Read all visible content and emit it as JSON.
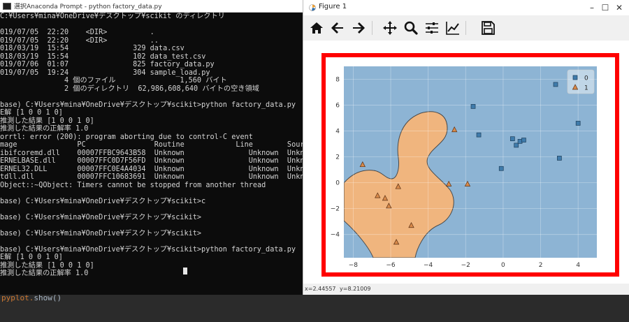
{
  "console": {
    "title": "選択Anaconda Prompt - python  factory_data.py",
    "lines": [
      "C:¥Users¥mina¥OneDrive¥デスクトップ¥scikit のディレクトリ",
      "",
      "019/07/05  22:20    <DIR>          .",
      "019/07/05  22:20    <DIR>          ..",
      "018/03/19  15:54               329 data.csv",
      "018/03/19  15:54               102 data_test.csv",
      "019/07/06  01:07               825 factory_data.py",
      "019/07/05  19:24               304 sample_load.py",
      "               4 個のファイル               1,560 バイト",
      "               2 個のディレクトリ  62,986,608,640 バイトの空き領域",
      "",
      "base) C:¥Users¥mina¥OneDrive¥デスクトップ¥scikit>python factory_data.py",
      "E解 [1 0 0 1 0]",
      "推測した結果 [1 0 0 1 0]",
      "推測した結果の正解率 1.0",
      "orrtl: error (200): program aborting due to control-C event",
      "mage              PC                Routine            Line        Source",
      "ibifcoremd.dll    00007FFBC9643B58  Unknown               Unknown  Unknown",
      "ERNELBASE.dll     00007FFC0D7F56FD  Unknown               Unknown  Unknown",
      "ERNEL32.DLL       00007FFC0E4A4034  Unknown               Unknown  Unknown",
      "tdll.dll          00007FFC10683691  Unknown               Unknown  Unknown",
      "Object::~QObject: Timers cannot be stopped from another thread",
      "",
      "base) C:¥Users¥mina¥OneDrive¥デスクトップ¥scikit>c",
      "",
      "base) C:¥Users¥mina¥OneDrive¥デスクトップ¥scikit>",
      "",
      "base) C:¥Users¥mina¥OneDrive¥デスクトップ¥scikit>",
      "",
      "base) C:¥Users¥mina¥OneDrive¥デスクトップ¥scikit>python factory_data.py",
      "E解 [1 0 0 1 0]",
      "推測した結果 [1 0 0 1 0]",
      "推測した結果の正解率 1.0"
    ]
  },
  "editor": {
    "code_prefix": "pyplot.",
    "code_call": "show()"
  },
  "figure": {
    "title": "Figure 1",
    "window_buttons": [
      "–",
      "☐",
      "✕"
    ],
    "toolbar": [
      {
        "icon": "home-icon"
      },
      {
        "icon": "back-arrow-icon"
      },
      {
        "icon": "forward-arrow-icon"
      },
      {
        "icon": "pan-move-icon"
      },
      {
        "icon": "zoom-magnifier-icon"
      },
      {
        "icon": "subplots-config-icon"
      },
      {
        "icon": "edit-axis-icon"
      },
      {
        "icon": "save-floppy-icon"
      }
    ],
    "status_x": "x=2.44557",
    "status_y": "y=8.21009"
  },
  "chart_data": {
    "type": "scatter",
    "xlim": [
      -8.5,
      5
    ],
    "ylim": [
      -5.8,
      9
    ],
    "x_ticks": [
      -8,
      -6,
      -4,
      -2,
      0,
      2,
      4
    ],
    "y_ticks": [
      -4,
      -2,
      0,
      2,
      4,
      6,
      8
    ],
    "grid": true,
    "legend_position": "top-right",
    "background_regions": {
      "class_0": "#8db4d4",
      "class_1": "#f0b57e"
    },
    "series": [
      {
        "name": "0",
        "marker": "square",
        "color": "#3f7bab",
        "points": [
          [
            2.8,
            7.6
          ],
          [
            4.0,
            4.6
          ],
          [
            -1.6,
            5.9
          ],
          [
            -1.3,
            3.7
          ],
          [
            0.5,
            3.4
          ],
          [
            0.7,
            2.9
          ],
          [
            0.9,
            3.2
          ],
          [
            1.1,
            3.3
          ],
          [
            3.0,
            1.9
          ],
          [
            -0.1,
            1.1
          ]
        ]
      },
      {
        "name": "1",
        "marker": "triangle",
        "color": "#d98a4a",
        "points": [
          [
            -2.6,
            4.1
          ],
          [
            -7.5,
            1.4
          ],
          [
            -5.6,
            -0.3
          ],
          [
            -6.7,
            -1.0
          ],
          [
            -6.3,
            -1.2
          ],
          [
            -6.1,
            -1.8
          ],
          [
            -4.9,
            -3.3
          ],
          [
            -5.7,
            -4.6
          ],
          [
            -2.9,
            -0.1
          ],
          [
            -1.9,
            -0.1
          ]
        ]
      }
    ]
  }
}
